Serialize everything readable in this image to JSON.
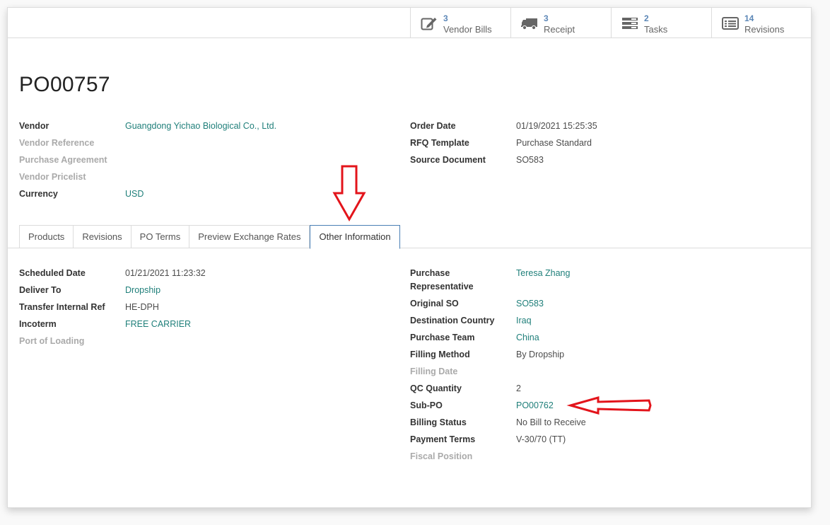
{
  "smart_buttons": [
    {
      "count": "3",
      "label": "Vendor Bills",
      "icon": "pencil-square-icon"
    },
    {
      "count": "3",
      "label": "Receipt",
      "icon": "truck-icon"
    },
    {
      "count": "2",
      "label": "Tasks",
      "icon": "tasks-icon"
    },
    {
      "count": "14",
      "label": "Revisions",
      "icon": "list-alt-icon"
    }
  ],
  "title": "PO00757",
  "header_left": {
    "vendor_label": "Vendor",
    "vendor_value": "Guangdong Yichao Biological Co., Ltd.",
    "vendor_ref_label": "Vendor Reference",
    "purchase_agreement_label": "Purchase Agreement",
    "vendor_pricelist_label": "Vendor Pricelist",
    "currency_label": "Currency",
    "currency_value": "USD"
  },
  "header_right": {
    "order_date_label": "Order Date",
    "order_date_value": "01/19/2021 15:25:35",
    "rfq_template_label": "RFQ Template",
    "rfq_template_value": "Purchase Standard",
    "source_doc_label": "Source Document",
    "source_doc_value": "SO583"
  },
  "tabs": [
    {
      "label": "Products"
    },
    {
      "label": "Revisions"
    },
    {
      "label": "PO Terms"
    },
    {
      "label": "Preview Exchange Rates"
    },
    {
      "label": "Other Information",
      "active": true
    }
  ],
  "other_left": {
    "scheduled_date_label": "Scheduled Date",
    "scheduled_date_value": "01/21/2021 11:23:32",
    "deliver_to_label": "Deliver To",
    "deliver_to_value": "Dropship",
    "transfer_ref_label": "Transfer Internal Ref",
    "transfer_ref_value": "HE-DPH",
    "incoterm_label": "Incoterm",
    "incoterm_value": "FREE CARRIER",
    "port_loading_label": "Port of Loading"
  },
  "other_right": {
    "purchase_rep_label_1": "Purchase",
    "purchase_rep_label_2": "Representative",
    "purchase_rep_value": "Teresa Zhang",
    "original_so_label": "Original SO",
    "original_so_value": "SO583",
    "dest_country_label": "Destination Country",
    "dest_country_value": "Iraq",
    "purchase_team_label": "Purchase Team",
    "purchase_team_value": "China",
    "filling_method_label": "Filling Method",
    "filling_method_value": "By Dropship",
    "filling_date_label": "Filling Date",
    "qc_qty_label": "QC Quantity",
    "qc_qty_value": "2",
    "sub_po_label": "Sub-PO",
    "sub_po_value": "PO00762",
    "billing_status_label": "Billing Status",
    "billing_status_value": "No Bill to Receive",
    "payment_terms_label": "Payment Terms",
    "payment_terms_value": "V-30/70 (TT)",
    "fiscal_position_label": "Fiscal Position"
  },
  "colors": {
    "link": "#1f7f7a",
    "smart_count": "#5c87b7",
    "annotation_arrow": "#e3141b",
    "active_tab_border": "#4a7fb5"
  }
}
